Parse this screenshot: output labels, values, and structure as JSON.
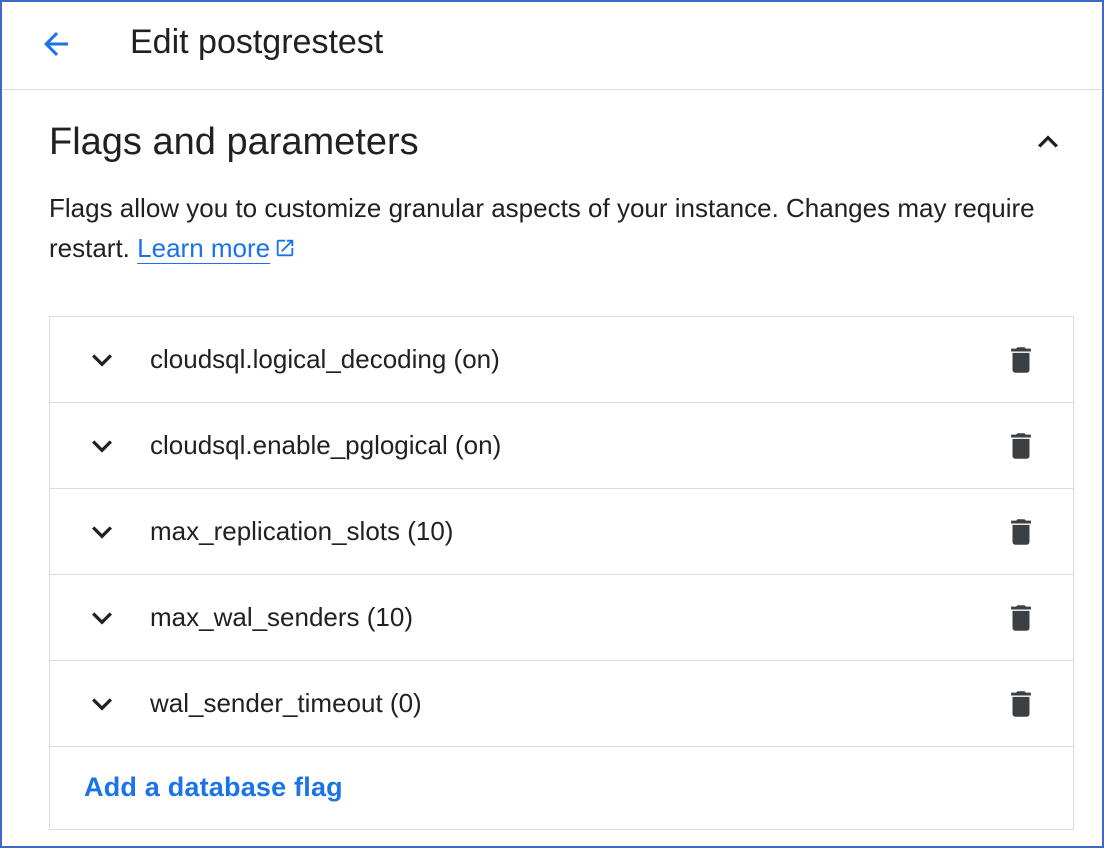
{
  "header": {
    "title": "Edit postgrestest",
    "back_icon": "arrow-back-icon"
  },
  "section": {
    "title": "Flags and parameters",
    "collapse_icon": "chevron-up-icon",
    "description": "Flags allow you to customize granular aspects of your instance. Changes may require restart.",
    "learn_more_label": "Learn more",
    "learn_more_icon": "open-in-new-icon"
  },
  "flags": [
    {
      "label": "cloudsql.logical_decoding (on)"
    },
    {
      "label": "cloudsql.enable_pglogical (on)"
    },
    {
      "label": "max_replication_slots (10)"
    },
    {
      "label": "max_wal_senders (10)"
    },
    {
      "label": "wal_sender_timeout (0)"
    }
  ],
  "row_icons": {
    "expand": "chevron-down-icon",
    "delete": "trash-icon"
  },
  "add_flag_label": "Add a database flag",
  "colors": {
    "accent": "#1a73e8",
    "text": "#202124",
    "icon": "#3c4043",
    "divider": "#dadce0",
    "frame": "#3c6ac6"
  }
}
